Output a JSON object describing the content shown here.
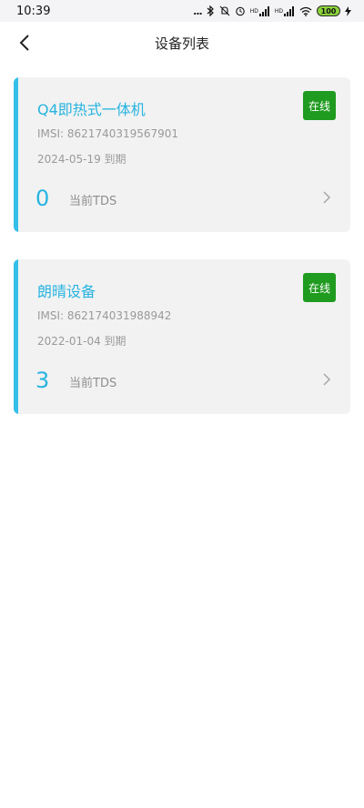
{
  "status_bar": {
    "time": "10:39",
    "dots": "...",
    "net_label_1": "HD",
    "net_label_2": "HD",
    "battery": "100"
  },
  "nav": {
    "title": "设备列表",
    "back_icon": "chevron-left-icon"
  },
  "devices": [
    {
      "name": "Q4即热式一体机",
      "status": "在线",
      "imsi": "IMSI: 862174031956790​1",
      "expire": "2024-05-19 到期",
      "tds_value": "0",
      "tds_label": "当前TDS"
    },
    {
      "name": "朗晴设备",
      "status": "在线",
      "imsi": "IMSI: 862174031988942",
      "expire": "2022-01-04 到期",
      "tds_value": "3",
      "tds_label": "当前TDS"
    }
  ],
  "colors": {
    "accent": "#33bfe8",
    "online": "#1f9b1f",
    "card_bg": "#f2f2f2"
  }
}
